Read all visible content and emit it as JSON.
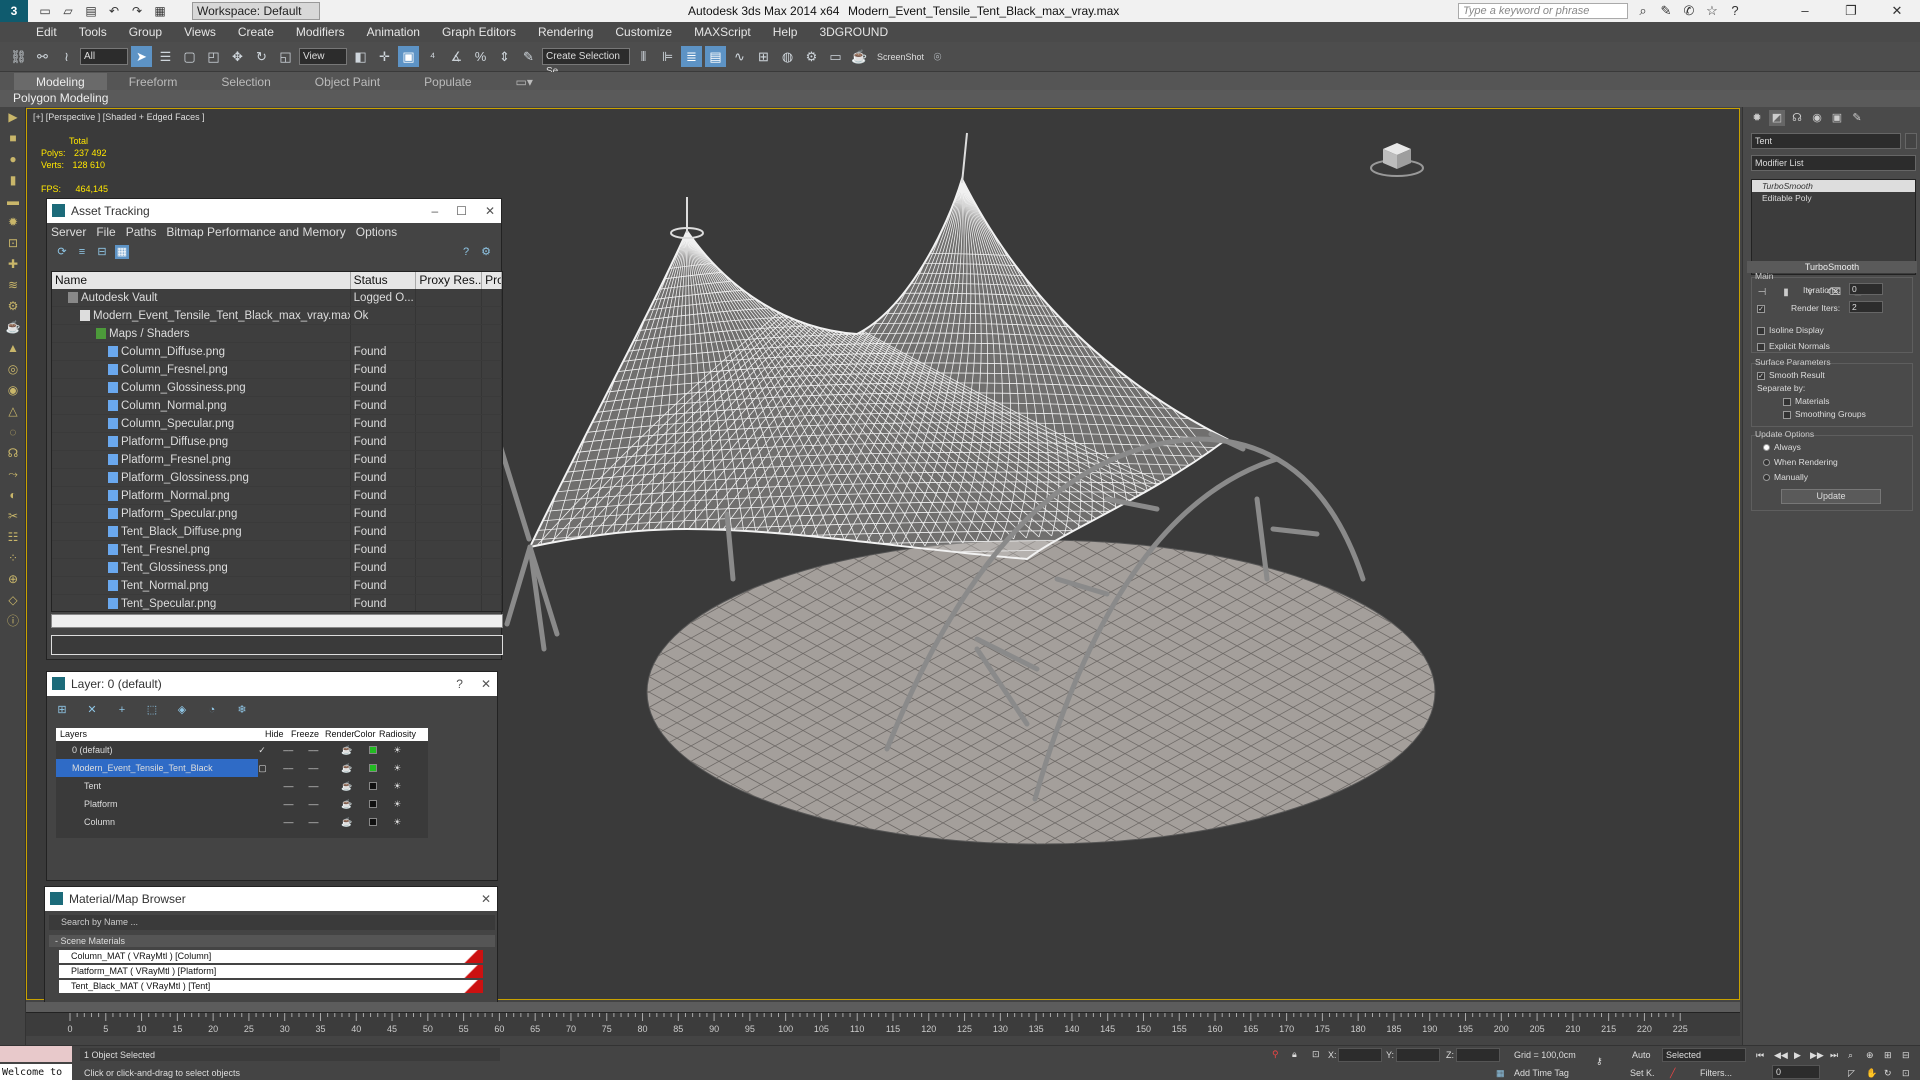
{
  "window": {
    "logo": "3",
    "workspace": "Workspace: Default",
    "app_name": "Autodesk 3ds Max  2014 x64",
    "file_name": "Modern_Event_Tensile_Tent_Black_max_vray.max",
    "search_placeholder": "Type a keyword or phrase"
  },
  "menu": [
    "Edit",
    "Tools",
    "Group",
    "Views",
    "Create",
    "Modifiers",
    "Animation",
    "Graph Editors",
    "Rendering",
    "Customize",
    "MAXScript",
    "Help",
    "3DGROUND"
  ],
  "toolbar": {
    "selection_filter": "All",
    "ref_coord": "View",
    "named_selection": "Create Selection Se",
    "screenshot_label": "ScreenShot"
  },
  "ribbon": {
    "tabs": [
      "Modeling",
      "Freeform",
      "Selection",
      "Object Paint",
      "Populate"
    ],
    "active": "Modeling",
    "sub": "Polygon Modeling"
  },
  "viewport": {
    "label": "[+] [Perspective ] [Shaded + Edged Faces ]",
    "stats_header": "Total",
    "polys_label": "Polys:",
    "polys": "237 492",
    "verts_label": "Verts:",
    "verts": "128 610",
    "fps_label": "FPS:",
    "fps": "464,145"
  },
  "asset_tracking": {
    "title": "Asset Tracking",
    "menu": [
      "Server",
      "File",
      "Paths",
      "Bitmap Performance and Memory",
      "Options"
    ],
    "columns": [
      "Name",
      "Status",
      "Proxy Res...",
      "Pro"
    ],
    "rows": [
      {
        "name": "Autodesk Vault",
        "status": "Logged O..."
      },
      {
        "name": "Modern_Event_Tensile_Tent_Black_max_vray.max",
        "status": "Ok"
      },
      {
        "name": "Maps / Shaders",
        "status": ""
      },
      {
        "name": "Column_Diffuse.png",
        "status": "Found"
      },
      {
        "name": "Column_Fresnel.png",
        "status": "Found"
      },
      {
        "name": "Column_Glossiness.png",
        "status": "Found"
      },
      {
        "name": "Column_Normal.png",
        "status": "Found"
      },
      {
        "name": "Column_Specular.png",
        "status": "Found"
      },
      {
        "name": "Platform_Diffuse.png",
        "status": "Found"
      },
      {
        "name": "Platform_Fresnel.png",
        "status": "Found"
      },
      {
        "name": "Platform_Glossiness.png",
        "status": "Found"
      },
      {
        "name": "Platform_Normal.png",
        "status": "Found"
      },
      {
        "name": "Platform_Specular.png",
        "status": "Found"
      },
      {
        "name": "Tent_Black_Diffuse.png",
        "status": "Found"
      },
      {
        "name": "Tent_Fresnel.png",
        "status": "Found"
      },
      {
        "name": "Tent_Glossiness.png",
        "status": "Found"
      },
      {
        "name": "Tent_Normal.png",
        "status": "Found"
      },
      {
        "name": "Tent_Specular.png",
        "status": "Found"
      }
    ]
  },
  "layer_manager": {
    "title": "Layer: 0 (default)",
    "help": "?",
    "columns": [
      "Layers",
      "Hide",
      "Freeze",
      "Render",
      "Color",
      "Radiosity"
    ],
    "rows": [
      {
        "name": "0 (default)",
        "color": "#22bb22"
      },
      {
        "name": "Modern_Event_Tensile_Tent_Black",
        "color": "#22bb22"
      },
      {
        "name": "Tent",
        "color": "#111111"
      },
      {
        "name": "Platform",
        "color": "#111111"
      },
      {
        "name": "Column",
        "color": "#111111"
      }
    ]
  },
  "material_browser": {
    "title": "Material/Map Browser",
    "search": "Search by Name ...",
    "section": "- Scene Materials",
    "materials": [
      "Column_MAT  ( VRayMtl )  [Column]",
      "Platform_MAT  ( VRayMtl )  [Platform]",
      "Tent_Black_MAT  ( VRayMtl )  [Tent]"
    ]
  },
  "command_panel": {
    "object_name": "Tent",
    "modifier_list": "Modifier List",
    "stack": [
      "TurboSmooth",
      "Editable Poly"
    ],
    "rollout": "TurboSmooth",
    "main_group": "Main",
    "iterations_label": "Iterations:",
    "iterations": "0",
    "render_iters_label": "Render Iters:",
    "render_iters": "2",
    "isoline": "Isoline Display",
    "explicit": "Explicit Normals",
    "surface_group": "Surface Parameters",
    "smooth_result": "Smooth Result",
    "separate_by": "Separate by:",
    "materials": "Materials",
    "smoothing_groups": "Smoothing Groups",
    "update_group": "Update Options",
    "always": "Always",
    "when_rendering": "When Rendering",
    "manually": "Manually",
    "update_btn": "Update"
  },
  "timeline": {
    "ticks": [
      "0",
      "5",
      "10",
      "15",
      "20",
      "25",
      "30",
      "35",
      "40",
      "45",
      "50",
      "55",
      "60",
      "65",
      "70",
      "75",
      "80",
      "85",
      "90",
      "95",
      "100",
      "105",
      "110",
      "115",
      "120",
      "125",
      "130",
      "135",
      "140",
      "145",
      "150",
      "155",
      "160",
      "165",
      "170",
      "175",
      "180",
      "185",
      "190",
      "195",
      "200",
      "205",
      "210",
      "215",
      "220",
      "225"
    ]
  },
  "status": {
    "maxscript": "Welcome to",
    "selected": "1 Object Selected",
    "prompt": "Click or click-and-drag to select objects",
    "x_label": "X:",
    "y_label": "Y:",
    "z_label": "Z:",
    "grid": "Grid = 100,0cm",
    "auto": "Auto",
    "selected_mode": "Selected",
    "setk": "Set K.",
    "filters": "Filters...",
    "add_time_tag": "Add Time Tag",
    "frame": "0"
  }
}
